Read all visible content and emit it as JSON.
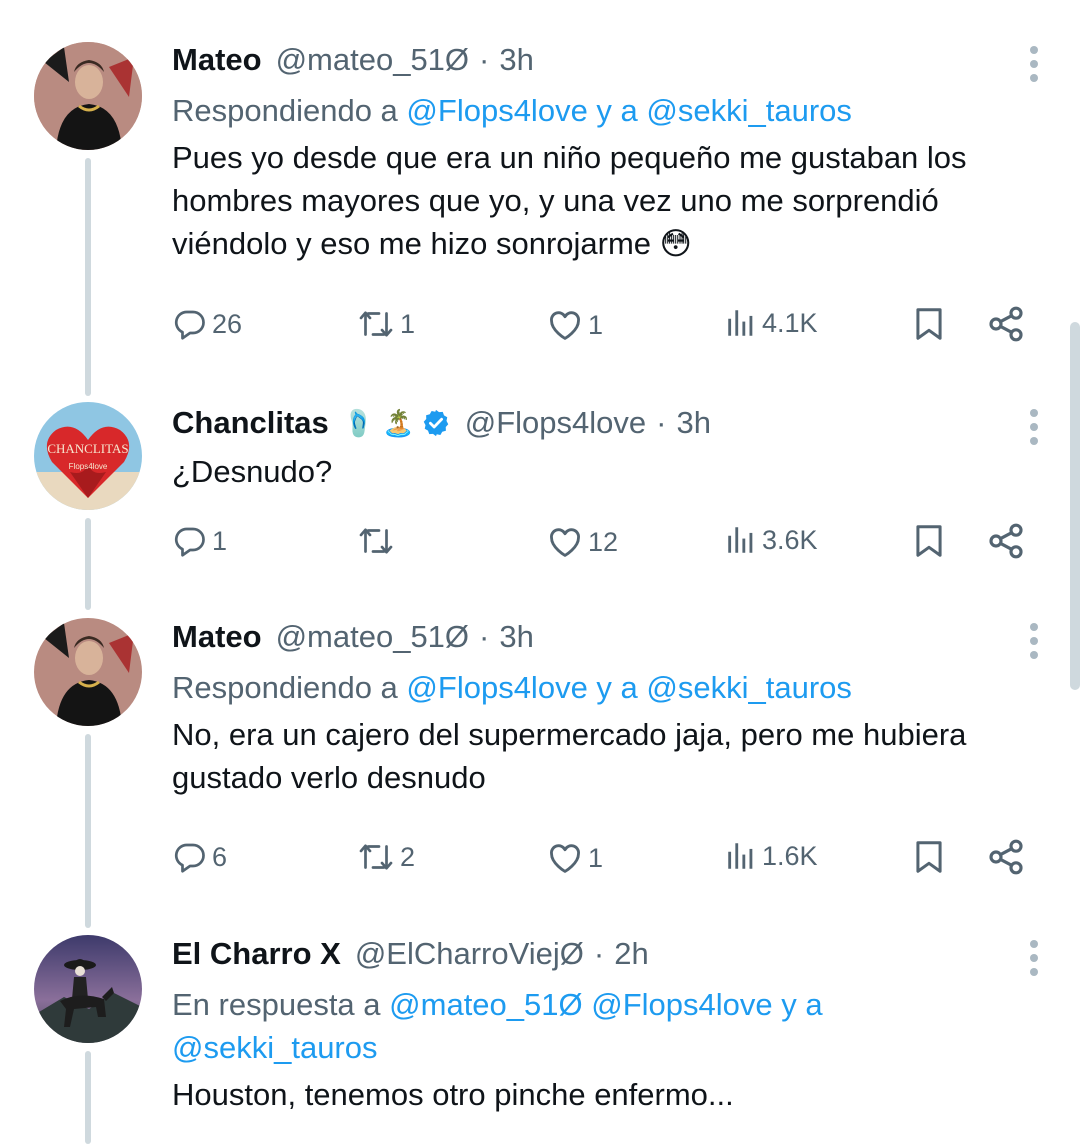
{
  "tweets": [
    {
      "name": "Mateo",
      "handle": "@mateo_51Ø",
      "separator": "·",
      "time": "3h",
      "reply_prefix": "Respondiendo a",
      "reply_mentions": "@Flops4love y a @sekki_tauros",
      "text": "Pues yo desde que era un niño pequeño me gustaban los hombres mayores que yo, y una vez uno me sorprendió viéndolo y eso me hizo sonrojarme 😳",
      "replies": "26",
      "retweets": "1",
      "likes": "1",
      "views": "4.1K"
    },
    {
      "name": "Chanclitas",
      "name_emojis": "🩴 🏝️",
      "avatar_text": "CHANCLITAS",
      "avatar_subtext": "Flops4love",
      "handle": "@Flops4love",
      "separator": "·",
      "time": "3h",
      "text": "¿Desnudo?",
      "replies": "1",
      "retweets": "",
      "likes": "12",
      "views": "3.6K"
    },
    {
      "name": "Mateo",
      "handle": "@mateo_51Ø",
      "separator": "·",
      "time": "3h",
      "reply_prefix": "Respondiendo a",
      "reply_mentions": "@Flops4love y a @sekki_tauros",
      "text": "No, era un cajero del supermercado jaja, pero me hubiera gustado verlo desnudo",
      "replies": "6",
      "retweets": "2",
      "likes": "1",
      "views": "1.6K"
    },
    {
      "name": "El Charro X",
      "handle": "@ElCharroViejØ",
      "separator": "·",
      "time": "2h",
      "reply_prefix": "En respuesta a",
      "reply_mentions_line1": "@mateo_51Ø @Flops4love y a",
      "reply_mentions_line2": "@sekki_tauros",
      "text": "Houston, tenemos otro pinche enfermo..."
    }
  ],
  "colors": {
    "accent": "#1d9bf0",
    "secondary_text": "#536471",
    "thread_line": "#cfd9de",
    "verified": "#1d9bf0"
  },
  "icons": [
    "reply-icon",
    "retweet-icon",
    "like-icon",
    "views-icon",
    "bookmark-icon",
    "share-icon",
    "more-icon",
    "verified-badge-icon"
  ]
}
